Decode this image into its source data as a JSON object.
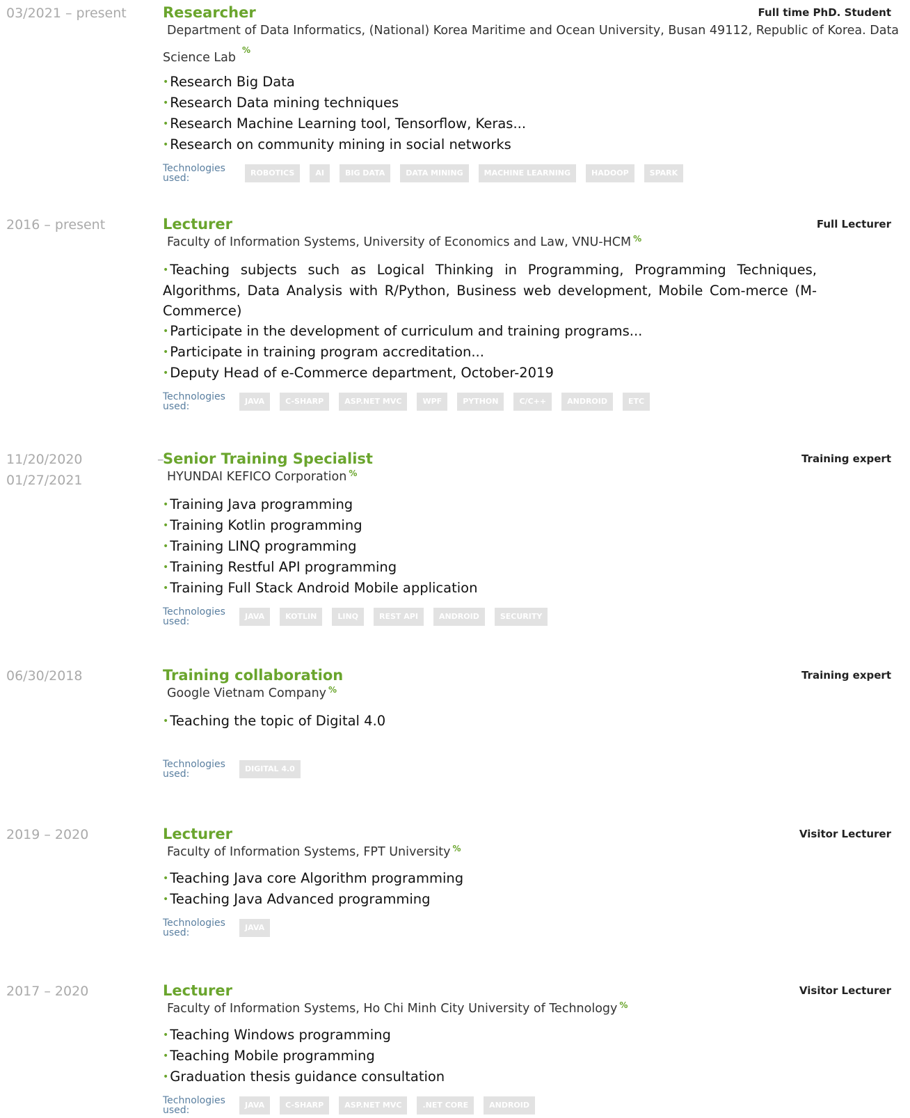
{
  "tech_label": "Technologies used:",
  "link_icon": "link-icon",
  "colors": {
    "accent": "#6aa52d",
    "date": "#aaaaaa",
    "tag_bg": "#e2e2e2",
    "tech_label": "#5a7fa0"
  },
  "entries": [
    {
      "date": "03/2021 – present",
      "title": "Researcher",
      "role": "Full time PhD. Student",
      "company": "Department of Data Informatics, (National) Korea Maritime and Ocean University, Busan 49112, Republic of Korea. Data Science Lab",
      "bullets": [
        "Research Big Data",
        "Research Data mining techniques",
        "Research Machine Learning tool, Tensorflow, Keras...",
        "Research on community mining in social networks"
      ],
      "tags": [
        "Robotics",
        "AI",
        "Big Data",
        "Data Mining",
        "Machine Learning",
        "Hadoop",
        "Spark"
      ]
    },
    {
      "date": "2016 – present",
      "title": "Lecturer",
      "role": "Full Lecturer",
      "company": "Faculty of Information Systems, University of Economics and Law, VNU-HCM",
      "bullets": [
        "Teaching subjects such as Logical Thinking in Programming, Programming Techniques, Algorithms, Data Analysis with R/Python, Business web development, Mobile Com-merce (M-Commerce)",
        "Participate in the development of curriculum and training programs...",
        "Participate in training program accreditation...",
        "Deputy Head of e-Commerce department, October-2019"
      ],
      "tags": [
        "Java",
        "C-Sharp",
        "ASP.NET MVC",
        "WPF",
        "Python",
        "C/C++",
        "Android",
        "etc"
      ]
    },
    {
      "date": "11/20/2020",
      "date2": "01/27/2021",
      "dash": "–",
      "title": "Senior Training Specialist",
      "role": "Training expert",
      "company": "HYUNDAI KEFICO Corporation",
      "bullets": [
        "Training Java programming",
        "Training Kotlin programming",
        "Training LINQ programming",
        "Training Restful API programming",
        "Training Full Stack Android Mobile application"
      ],
      "tags": [
        "Java",
        "Kotlin",
        "LINQ",
        "REST API",
        "Android",
        "Security"
      ]
    },
    {
      "date": "06/30/2018",
      "title": "Training collaboration",
      "role": "Training expert",
      "company": "Google Vietnam Company",
      "bullets": [
        "Teaching the topic of Digital 4.0"
      ],
      "tags": [
        "Digital 4.0"
      ]
    },
    {
      "date": "2019 – 2020",
      "title": "Lecturer",
      "role": "Visitor Lecturer",
      "company": "Faculty of Information Systems, FPT University",
      "bullets": [
        "Teaching Java core Algorithm programming",
        "Teaching Java Advanced programming"
      ],
      "tags": [
        "Java"
      ]
    },
    {
      "date": "2017 – 2020",
      "title": "Lecturer",
      "role": "Visitor Lecturer",
      "company": "Faculty of Information Systems, Ho Chi Minh City University of Technology",
      "bullets": [
        "Teaching Windows programming",
        "Teaching Mobile programming",
        "Graduation thesis guidance consultation"
      ],
      "tags": [
        "Java",
        "C-Sharp",
        "ASP.NET MVC",
        ".NET Core",
        "Android"
      ]
    }
  ]
}
